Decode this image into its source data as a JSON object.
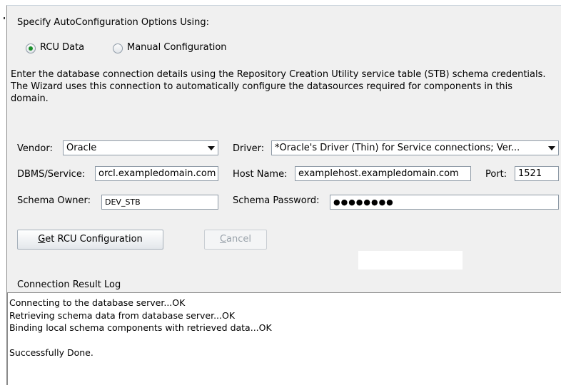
{
  "autoconfig": {
    "title": "Specify AutoConfiguration Options Using:",
    "options": [
      {
        "label": "RCU Data",
        "selected": true
      },
      {
        "label": "Manual Configuration",
        "selected": false
      }
    ]
  },
  "description": "Enter the database connection details using the Repository Creation Utility service table (STB) schema credentials. The Wizard uses this connection to automatically configure the datasources required for components in this domain.",
  "form": {
    "vendor_label": "Vendor:",
    "vendor_value": "Oracle",
    "driver_label": "Driver:",
    "driver_value": "*Oracle's Driver (Thin) for Service connections; Ver...",
    "dbms_label": "DBMS/Service:",
    "dbms_value": "orcl.exampledomain.com",
    "host_label": "Host Name:",
    "host_value": "examplehost.exampledomain.com",
    "port_label": "Port:",
    "port_value": "1521",
    "schema_owner_label": "Schema Owner:",
    "schema_owner_value": "DEV_STB",
    "schema_password_label": "Schema Password:",
    "schema_password_value": "●●●●●●●●"
  },
  "buttons": {
    "get_rcu_prefix": "G",
    "get_rcu_rest": "et RCU Configuration",
    "cancel_prefix": "C",
    "cancel_rest": "ancel"
  },
  "log": {
    "title": "Connection Result Log",
    "lines": [
      "Connecting to the database server...OK",
      "Retrieving schema data from database server...OK",
      "Binding local schema components with retrieved data...OK",
      "",
      "Successfully Done."
    ]
  }
}
